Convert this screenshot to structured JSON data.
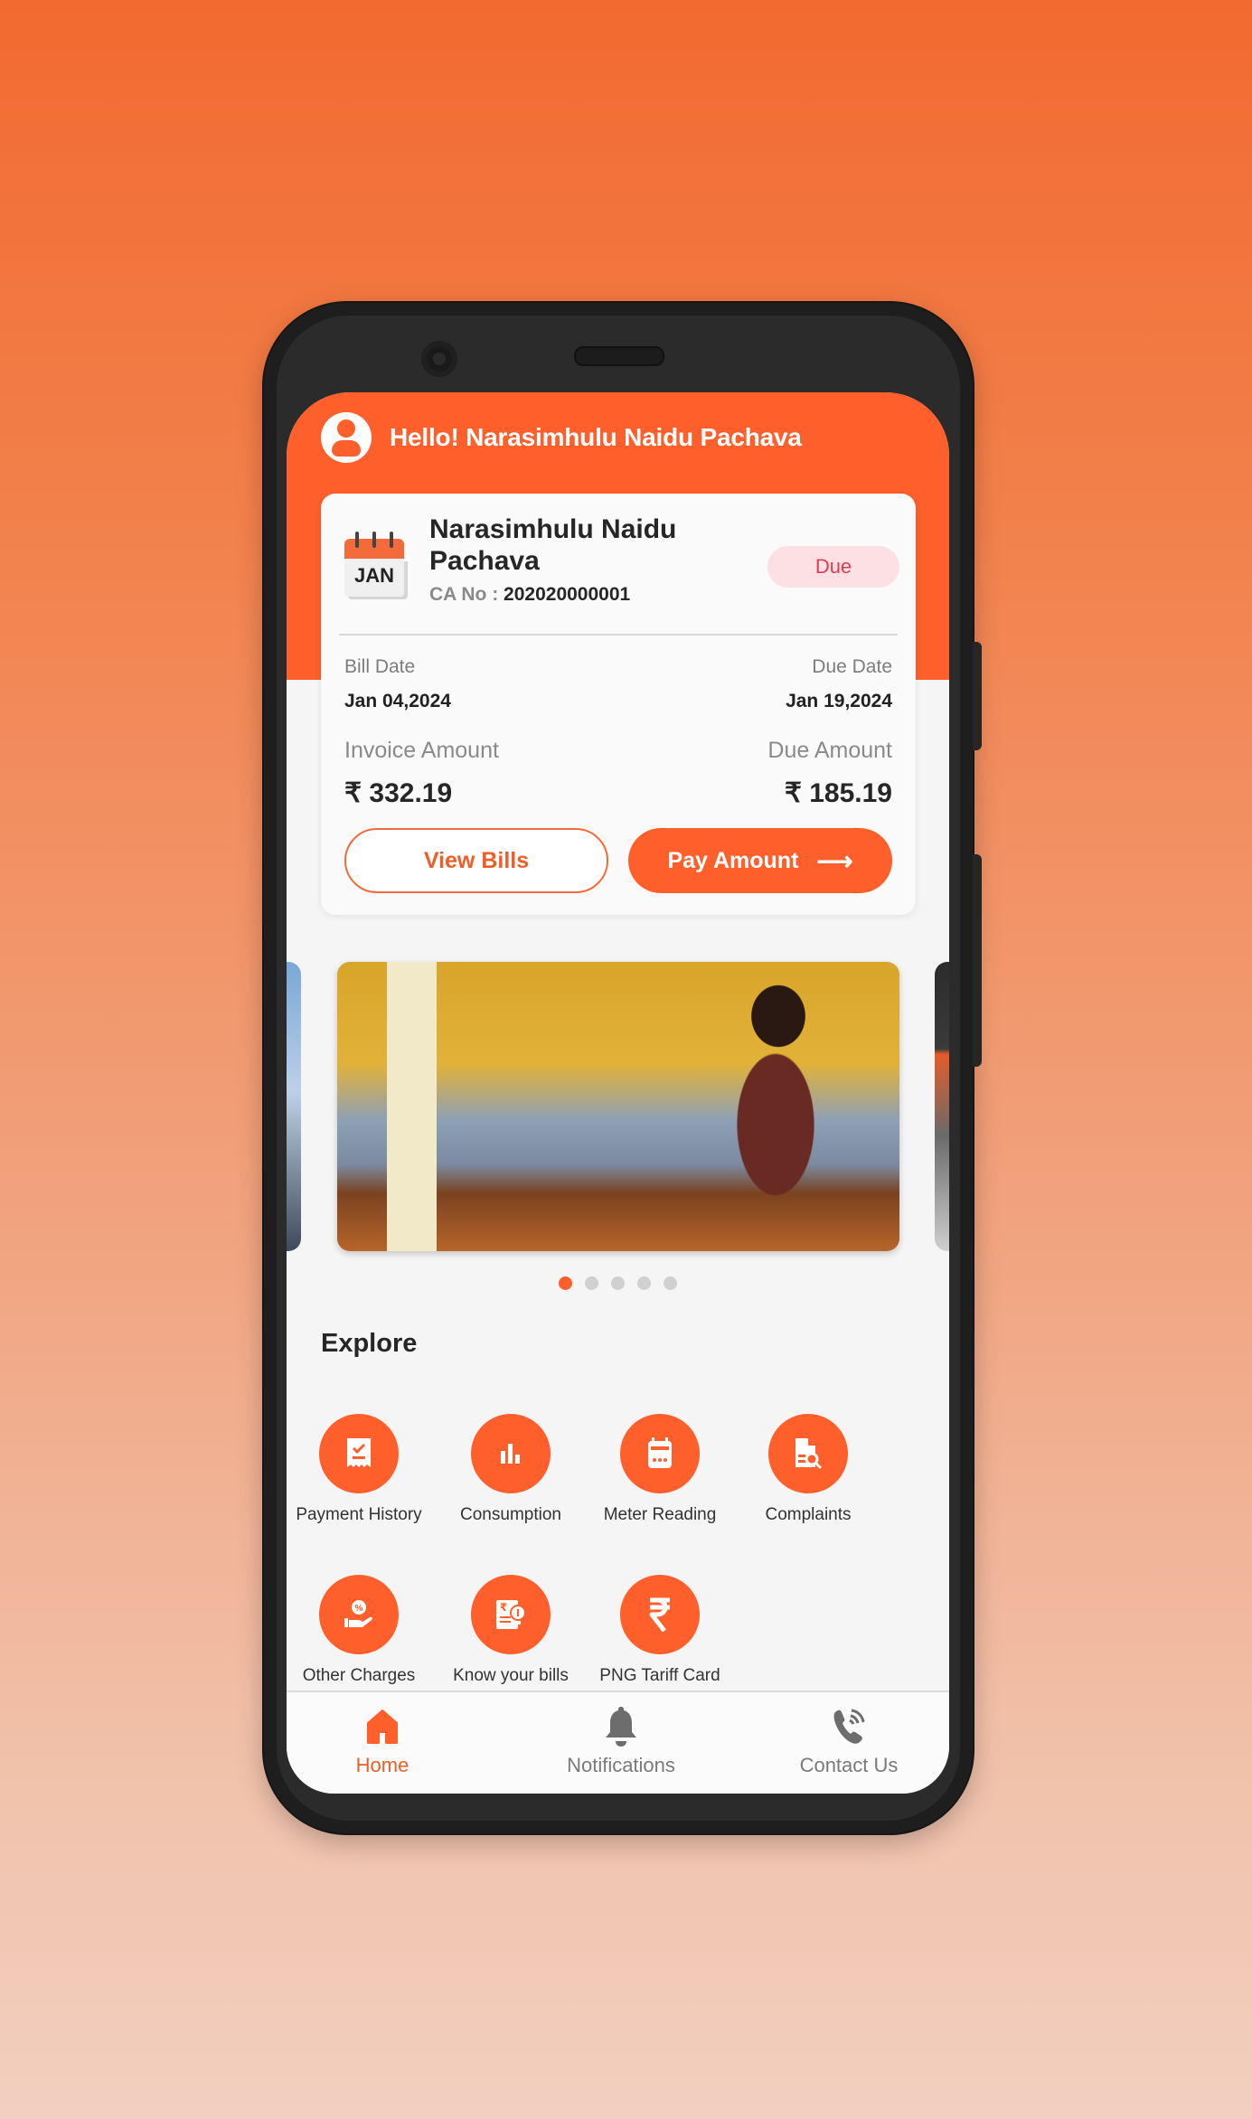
{
  "header": {
    "greeting": "Hello! Narasimhulu Naidu Pachava"
  },
  "bill_card": {
    "calendar_month": "JAN",
    "customer_name": "Narasimhulu Naidu Pachava",
    "ca_label": "CA No : ",
    "ca_number": "202020000001",
    "status_badge": "Due",
    "bill_date_label": "Bill Date",
    "bill_date": "Jan 04,2024",
    "due_date_label": "Due Date",
    "due_date": "Jan 19,2024",
    "invoice_amount_label": "Invoice Amount",
    "invoice_amount": "₹ 332.19",
    "due_amount_label": "Due Amount",
    "due_amount": "₹ 185.19",
    "view_bills_label": "View Bills",
    "pay_amount_label": "Pay Amount",
    "pay_arrow": "⟶"
  },
  "carousel": {
    "slide_count": 5,
    "active_index": 0
  },
  "explore": {
    "title": "Explore",
    "items": [
      {
        "label": "Payment History",
        "icon": "receipt-check-icon"
      },
      {
        "label": "Consumption",
        "icon": "bar-chart-icon"
      },
      {
        "label": "Meter Reading",
        "icon": "meter-icon"
      },
      {
        "label": "Complaints",
        "icon": "document-search-icon"
      },
      {
        "label": "Other Charges",
        "icon": "hand-percent-icon"
      },
      {
        "label": "Know your bills",
        "icon": "bill-bulb-icon"
      },
      {
        "label": "PNG Tariff Card",
        "icon": "rupee-icon"
      }
    ]
  },
  "bottom_nav": {
    "items": [
      {
        "label": "Home",
        "icon": "home-icon",
        "active": true
      },
      {
        "label": "Notifications",
        "icon": "bell-icon",
        "active": false
      },
      {
        "label": "Contact Us",
        "icon": "phone-call-icon",
        "active": false
      }
    ]
  },
  "colors": {
    "accent": "#fe5f2b",
    "due_badge_bg": "#fde0e4",
    "due_badge_text": "#e03b54",
    "inactive_dot": "#d0d0d0"
  }
}
